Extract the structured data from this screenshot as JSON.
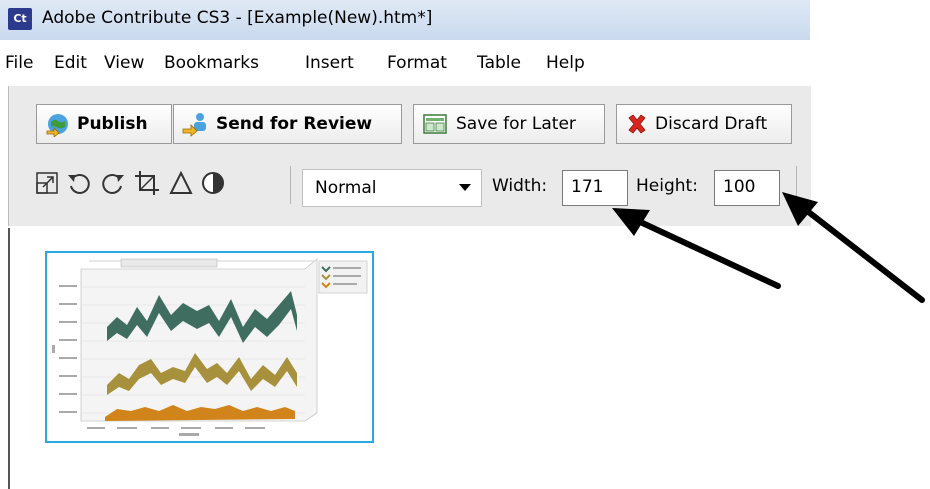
{
  "window": {
    "app_icon": "Ct",
    "title": "Adobe Contribute CS3 - [Example(New).htm*]"
  },
  "menu": [
    "File",
    "Edit",
    "View",
    "Bookmarks",
    "Insert",
    "Format",
    "Table",
    "Help"
  ],
  "toolbar": {
    "publish": "Publish",
    "send_for_review": "Send for Review",
    "save_for_later": "Save for Later",
    "discard_draft": "Discard Draft"
  },
  "image_tools": {
    "icons": [
      "resize-icon",
      "rotate-left-icon",
      "rotate-right-icon",
      "crop-icon",
      "sharpen-icon",
      "brightness-contrast-icon"
    ],
    "style_select": "Normal",
    "width_label": "Width:",
    "width_value": "171",
    "height_label": "Height:",
    "height_value": "100"
  },
  "colors": {
    "selection_border": "#27a9e1",
    "series_top": "#3f6e60",
    "series_mid": "#a8913c",
    "series_bottom": "#d1841a"
  }
}
